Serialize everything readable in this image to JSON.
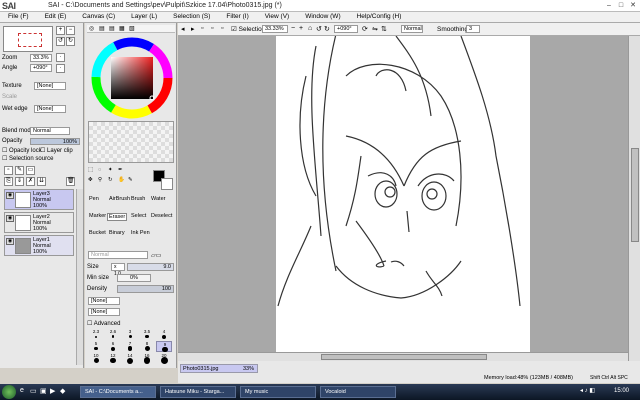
{
  "titlebar": {
    "logo": "SAI",
    "title": "SAI - C:\\Documents and Settings\\pev\\Pulpit\\Szkice 17.04\\Photo0315.jpg (*)"
  },
  "menu": [
    "File (F)",
    "Edit (E)",
    "Canvas (C)",
    "Layer (L)",
    "Selection (S)",
    "Filter (I)",
    "View (V)",
    "Window (W)",
    "Help/Config (H)"
  ],
  "navigator": {
    "zoom_label": "Zoom",
    "zoom_value": "33.3%",
    "angle_label": "Angle",
    "angle_value": "+090°"
  },
  "texture": {
    "label": "Texture",
    "value": "[None]",
    "scale_label": "Scale",
    "wet_label": "Wet edge",
    "wet_value": "[None]"
  },
  "blend": {
    "label": "Blend mode",
    "value": "Normal",
    "opacity_label": "Opacity",
    "opacity_value": "100%",
    "opacity_lock": "Opacity lock",
    "layer_clip": "Layer clip",
    "selection_source": "Selection source"
  },
  "layers": [
    {
      "name": "Layer3",
      "mode": "Normal",
      "opacity": "100%"
    },
    {
      "name": "Layer2",
      "mode": "Normal",
      "opacity": "100%"
    },
    {
      "name": "Layer1",
      "mode": "Normal",
      "opacity": "100%"
    }
  ],
  "tools": [
    "Pen",
    "AirBrush",
    "Brush",
    "Water",
    "Marker",
    "Eraser",
    "Select",
    "Deselect",
    "Bucket",
    "Binary",
    "Ink Pen"
  ],
  "brush": {
    "mode": "Normal",
    "size_label": "Size",
    "size_mult": "x 1.0",
    "size_value": "9.0",
    "minsize_label": "Min size",
    "minsize_value": "0%",
    "density_label": "Density",
    "density_value": "100",
    "shape1": "[None]",
    "shape2": "[None]",
    "advanced": "Advanced"
  },
  "brush_sizes": [
    [
      "2.3",
      "2.6",
      "3",
      "3.5",
      "4"
    ],
    [
      "5",
      "6",
      "7",
      "8",
      "9"
    ],
    [
      "10",
      "12",
      "14",
      "16",
      "20"
    ]
  ],
  "toolbar": {
    "selection": "Selection",
    "zoom": "33.33%",
    "angle": "+090°",
    "mode": "Normal",
    "smoothing_label": "Smoothing",
    "smoothing_value": "3"
  },
  "status": {
    "tab": "Photo0315.jpg",
    "tab_zoom": "33%",
    "memory": "Memory load:48% (123MB / 408MB)",
    "keys": "Shift Ctrl Alt SPC"
  },
  "taskbar": {
    "items": [
      "SAI - C:\\Documents a...",
      "Hatsune Miku - Starga...",
      "My music",
      "Vocaloid"
    ],
    "clock": "15:00"
  },
  "colors": {
    "accent": "#3a6ea5",
    "layer_selected": "#c8c8f0",
    "canvas_bg": "#a8a8a8"
  }
}
